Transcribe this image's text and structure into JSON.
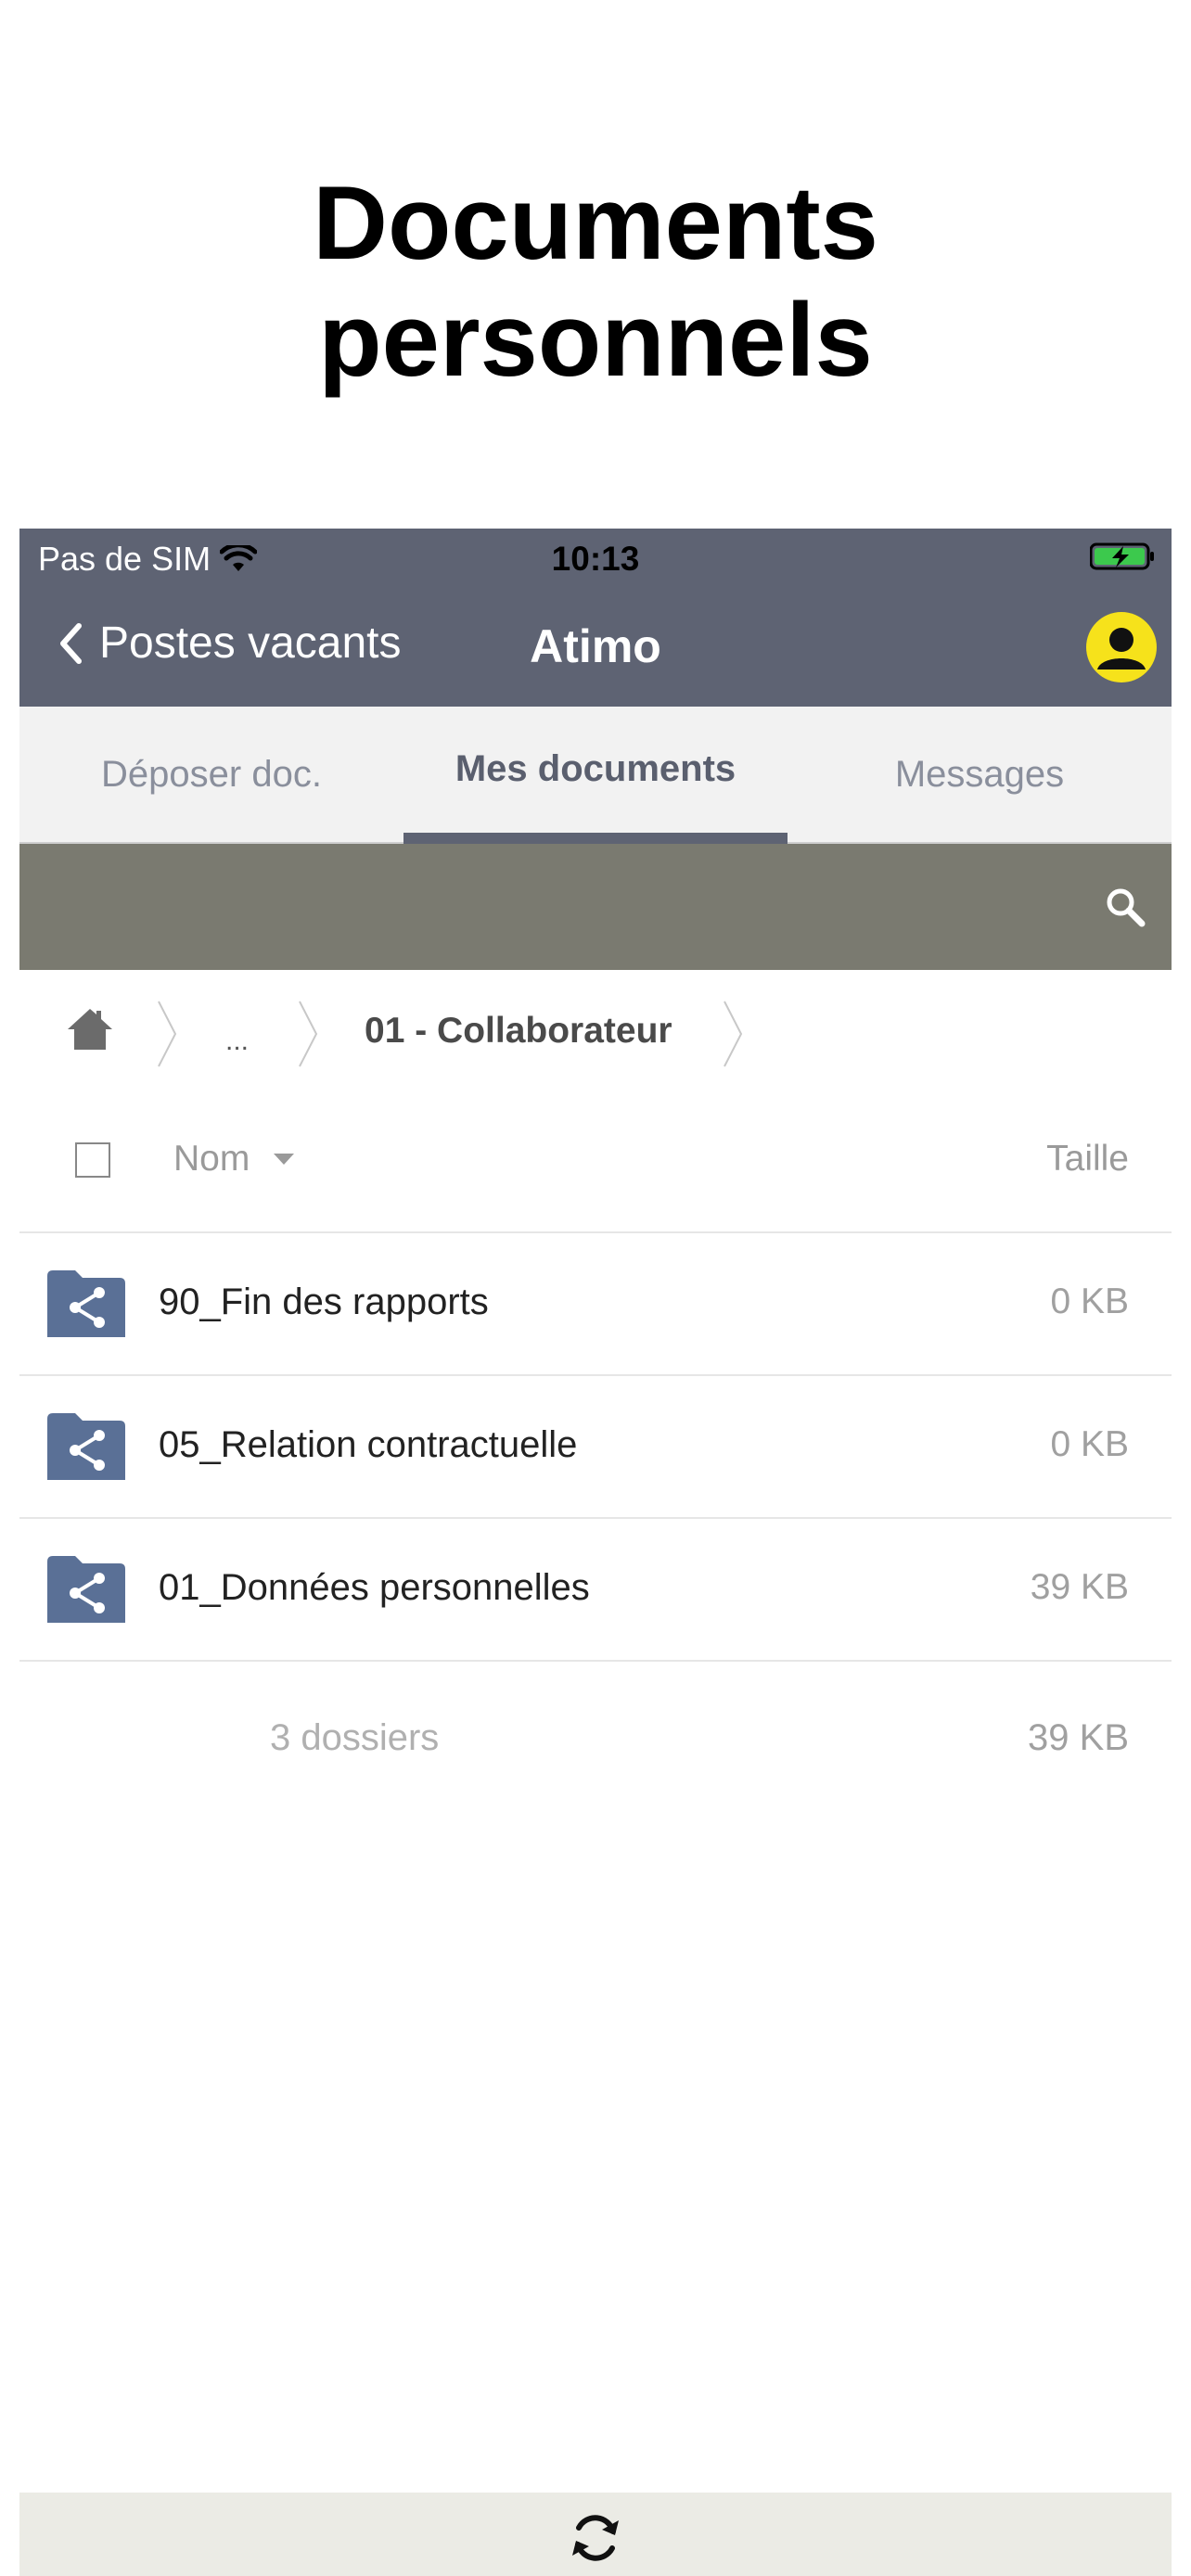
{
  "headline": {
    "line1": "Documents",
    "line2": "personnels"
  },
  "status_bar": {
    "carrier": "Pas de SIM",
    "time": "10:13",
    "icons": [
      "wifi-icon",
      "battery-charging-icon"
    ]
  },
  "nav": {
    "back_label": "Postes vacants",
    "title": "Atimo",
    "avatar_icon": "user-avatar-icon"
  },
  "tabs": [
    {
      "label": "Déposer doc.",
      "active": false
    },
    {
      "label": "Mes documents",
      "active": true
    },
    {
      "label": "Messages",
      "active": false
    }
  ],
  "search": {
    "icon": "search-icon"
  },
  "breadcrumb": {
    "home_icon": "home-icon",
    "ellipsis": "...",
    "current": "01 - Collaborateur"
  },
  "list": {
    "columns": {
      "name": "Nom",
      "size": "Taille"
    },
    "rows": [
      {
        "name": "90_Fin des rapports",
        "size": "0 KB",
        "icon": "shared-folder-icon"
      },
      {
        "name": "05_Relation contractuelle",
        "size": "0 KB",
        "icon": "shared-folder-icon"
      },
      {
        "name": "01_Données personnelles",
        "size": "39 KB",
        "icon": "shared-folder-icon"
      }
    ],
    "summary": {
      "count": "3 dossiers",
      "total": "39 KB"
    }
  },
  "bottom_bar": {
    "icon": "refresh-icon"
  },
  "colors": {
    "nav_bar": "#5e6373",
    "search_bar": "#7a7a70",
    "folder": "#5a7096",
    "avatar": "#f6e21b",
    "battery": "#3cc94d"
  }
}
